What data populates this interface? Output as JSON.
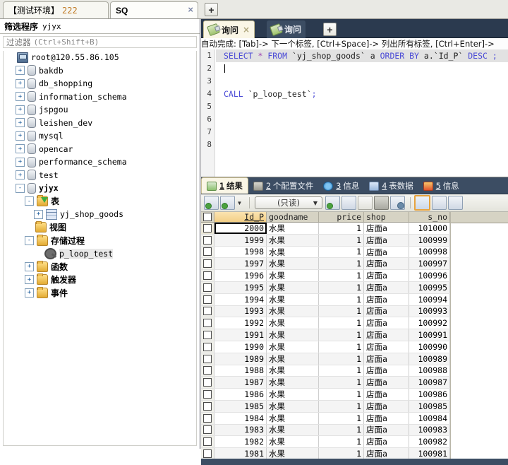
{
  "window_tabs": [
    {
      "label": "【测试环境】",
      "num": "222",
      "active": false
    },
    {
      "label": "SQ",
      "num": "",
      "active": true
    }
  ],
  "window_tab_close": "×",
  "add_tab_button": "+",
  "sidebar": {
    "header_label": "筛选程序",
    "header_db": "yjyx",
    "filter_placeholder_cn": "过滤器",
    "filter_placeholder_key": "(Ctrl+Shift+B)",
    "tree": [
      {
        "label": "root@120.55.86.105",
        "icon": "server-icon",
        "indent": 0,
        "expander": "",
        "bold": false
      },
      {
        "label": "bakdb",
        "icon": "database-icon",
        "indent": 1,
        "expander": "+",
        "bold": false
      },
      {
        "label": "db_shopping",
        "icon": "database-icon",
        "indent": 1,
        "expander": "+",
        "bold": false
      },
      {
        "label": "information_schema",
        "icon": "database-icon",
        "indent": 1,
        "expander": "+",
        "bold": false
      },
      {
        "label": "jspgou",
        "icon": "database-icon",
        "indent": 1,
        "expander": "+",
        "bold": false
      },
      {
        "label": "leishen_dev",
        "icon": "database-icon",
        "indent": 1,
        "expander": "+",
        "bold": false
      },
      {
        "label": "mysql",
        "icon": "database-icon",
        "indent": 1,
        "expander": "+",
        "bold": false
      },
      {
        "label": "opencar",
        "icon": "database-icon",
        "indent": 1,
        "expander": "+",
        "bold": false
      },
      {
        "label": "performance_schema",
        "icon": "database-icon",
        "indent": 1,
        "expander": "+",
        "bold": false
      },
      {
        "label": "test",
        "icon": "database-icon",
        "indent": 1,
        "expander": "+",
        "bold": false
      },
      {
        "label": "yjyx",
        "icon": "database-icon",
        "indent": 1,
        "expander": "-",
        "bold": true
      },
      {
        "label": "表",
        "icon": "folder-table-icon",
        "indent": 2,
        "expander": "-",
        "bold": true,
        "cn": true
      },
      {
        "label": "yj_shop_goods",
        "icon": "table-icon",
        "indent": 3,
        "expander": "+",
        "bold": false
      },
      {
        "label": "视图",
        "icon": "folder-icon",
        "indent": 2,
        "expander": "",
        "bold": true,
        "cn": true
      },
      {
        "label": "存储过程",
        "icon": "folder-icon",
        "indent": 2,
        "expander": "-",
        "bold": true,
        "cn": true
      },
      {
        "label": "p_loop_test",
        "icon": "procedure-icon",
        "indent": 3,
        "expander": "",
        "bold": false,
        "selected": true
      },
      {
        "label": "函数",
        "icon": "folder-icon",
        "indent": 2,
        "expander": "+",
        "bold": true,
        "cn": true
      },
      {
        "label": "触发器",
        "icon": "folder-icon",
        "indent": 2,
        "expander": "+",
        "bold": true,
        "cn": true
      },
      {
        "label": "事件",
        "icon": "folder-icon",
        "indent": 2,
        "expander": "+",
        "bold": true,
        "cn": true
      }
    ]
  },
  "editor": {
    "tabs": [
      {
        "label": "询问",
        "active": true,
        "closable": true
      },
      {
        "label": "询问",
        "active": false,
        "closable": false
      }
    ],
    "close_glyph": "×",
    "add_button": "+",
    "autocomplete_hint": "自动完成: [Tab]-> 下一个标签, [Ctrl+Space]-> 列出所有标签, [Ctrl+Enter]->",
    "line_numbers": [
      "1",
      "2",
      "3",
      "4",
      "5",
      "6",
      "7",
      "8"
    ],
    "lines": [
      {
        "n": 1,
        "highlight": true,
        "tokens": [
          {
            "t": "SELECT ",
            "c": "kw"
          },
          {
            "t": "* ",
            "c": "star"
          },
          {
            "t": "FROM ",
            "c": "kw"
          },
          {
            "t": "`yj_shop_goods` ",
            "c": "ident"
          },
          {
            "t": "a ",
            "c": "ident"
          },
          {
            "t": "ORDER BY ",
            "c": "kw"
          },
          {
            "t": "a.",
            "c": "ident"
          },
          {
            "t": "`Id_P` ",
            "c": "ident"
          },
          {
            "t": "DESC ",
            "c": "kw"
          },
          {
            "t": ";",
            "c": "punc"
          }
        ]
      },
      {
        "n": 2,
        "highlight": false,
        "caret": true,
        "tokens": []
      },
      {
        "n": 3,
        "highlight": false,
        "tokens": []
      },
      {
        "n": 4,
        "highlight": false,
        "tokens": [
          {
            "t": "CALL ",
            "c": "kw"
          },
          {
            "t": "`p_loop_test`",
            "c": "ident"
          },
          {
            "t": ";",
            "c": "punc"
          }
        ]
      },
      {
        "n": 5,
        "highlight": false,
        "tokens": []
      },
      {
        "n": 6,
        "highlight": false,
        "tokens": []
      },
      {
        "n": 7,
        "highlight": false,
        "tokens": []
      },
      {
        "n": 8,
        "highlight": false,
        "tokens": []
      }
    ]
  },
  "result_tabs": [
    {
      "num": "1",
      "label": "结果",
      "icon": "result-grid-icon",
      "active": true
    },
    {
      "num": "2",
      "label": "个配置文件",
      "icon": "profile-icon",
      "active": false
    },
    {
      "num": "3",
      "label": "信息",
      "icon": "info-icon",
      "active": false
    },
    {
      "num": "4",
      "label": "表数据",
      "icon": "table-data-icon",
      "active": false
    },
    {
      "num": "5",
      "label": "信息",
      "icon": "status-icon",
      "active": false
    }
  ],
  "grid_toolbar": {
    "readonly_label": "(只读)",
    "dropdown_arrow": "▼",
    "buttons": [
      {
        "name": "add-record-button"
      },
      {
        "name": "add-record-dropdown-button"
      },
      {
        "name": "insert-record-button"
      },
      {
        "name": "duplicate-record-button"
      },
      {
        "name": "save-record-button"
      },
      {
        "name": "delete-record-button"
      },
      {
        "name": "cancel-record-button"
      },
      {
        "name": "grid-view-button"
      },
      {
        "name": "form-view-button"
      },
      {
        "name": "text-view-button"
      }
    ]
  },
  "grid": {
    "columns": [
      {
        "key": "id",
        "label": "Id_P",
        "sorted": true,
        "align": "right"
      },
      {
        "key": "goodname",
        "label": "goodname",
        "sorted": false,
        "align": "left"
      },
      {
        "key": "price",
        "label": "price",
        "sorted": false,
        "align": "right"
      },
      {
        "key": "shop",
        "label": "shop",
        "sorted": false,
        "align": "left"
      },
      {
        "key": "s_no",
        "label": "s_no",
        "sorted": false,
        "align": "right"
      }
    ],
    "rows": [
      {
        "id": "2000",
        "goodname": "水果",
        "price": "1",
        "shop": "店面a",
        "s_no": "101000"
      },
      {
        "id": "1999",
        "goodname": "水果",
        "price": "1",
        "shop": "店面a",
        "s_no": "100999"
      },
      {
        "id": "1998",
        "goodname": "水果",
        "price": "1",
        "shop": "店面a",
        "s_no": "100998"
      },
      {
        "id": "1997",
        "goodname": "水果",
        "price": "1",
        "shop": "店面a",
        "s_no": "100997"
      },
      {
        "id": "1996",
        "goodname": "水果",
        "price": "1",
        "shop": "店面a",
        "s_no": "100996"
      },
      {
        "id": "1995",
        "goodname": "水果",
        "price": "1",
        "shop": "店面a",
        "s_no": "100995"
      },
      {
        "id": "1994",
        "goodname": "水果",
        "price": "1",
        "shop": "店面a",
        "s_no": "100994"
      },
      {
        "id": "1993",
        "goodname": "水果",
        "price": "1",
        "shop": "店面a",
        "s_no": "100993"
      },
      {
        "id": "1992",
        "goodname": "水果",
        "price": "1",
        "shop": "店面a",
        "s_no": "100992"
      },
      {
        "id": "1991",
        "goodname": "水果",
        "price": "1",
        "shop": "店面a",
        "s_no": "100991"
      },
      {
        "id": "1990",
        "goodname": "水果",
        "price": "1",
        "shop": "店面a",
        "s_no": "100990"
      },
      {
        "id": "1989",
        "goodname": "水果",
        "price": "1",
        "shop": "店面a",
        "s_no": "100989"
      },
      {
        "id": "1988",
        "goodname": "水果",
        "price": "1",
        "shop": "店面a",
        "s_no": "100988"
      },
      {
        "id": "1987",
        "goodname": "水果",
        "price": "1",
        "shop": "店面a",
        "s_no": "100987"
      },
      {
        "id": "1986",
        "goodname": "水果",
        "price": "1",
        "shop": "店面a",
        "s_no": "100986"
      },
      {
        "id": "1985",
        "goodname": "水果",
        "price": "1",
        "shop": "店面a",
        "s_no": "100985"
      },
      {
        "id": "1984",
        "goodname": "水果",
        "price": "1",
        "shop": "店面a",
        "s_no": "100984"
      },
      {
        "id": "1983",
        "goodname": "水果",
        "price": "1",
        "shop": "店面a",
        "s_no": "100983"
      },
      {
        "id": "1982",
        "goodname": "水果",
        "price": "1",
        "shop": "店面a",
        "s_no": "100982"
      },
      {
        "id": "1981",
        "goodname": "水果",
        "price": "1",
        "shop": "店面a",
        "s_no": "100981"
      }
    ]
  },
  "colors": {
    "accent_orange": "#c07a24",
    "tab_dark": "#2b3a4f",
    "tab_active_cream": "#faf6e6",
    "header_tan": "#d6d3c4",
    "sorted_header": "#f3cf86",
    "keyword_blue": "#4b4bd6"
  }
}
